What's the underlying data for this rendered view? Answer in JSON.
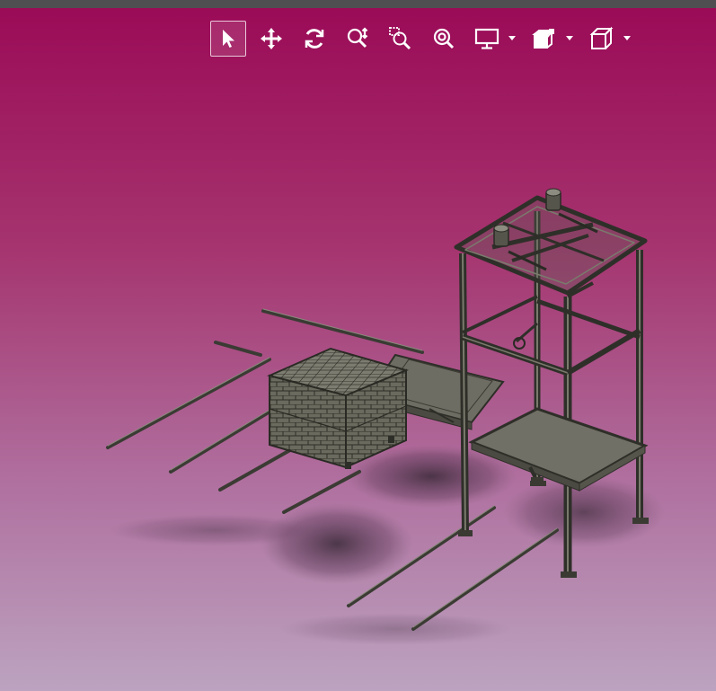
{
  "toolbar": {
    "buttons": [
      {
        "name": "select-icon",
        "active": true
      },
      {
        "name": "pan-icon",
        "active": false
      },
      {
        "name": "rotate-icon",
        "active": false
      },
      {
        "name": "zoom-icon",
        "active": false
      },
      {
        "name": "zoom-box-icon",
        "active": false
      },
      {
        "name": "zoom-fit-icon",
        "active": false
      },
      {
        "name": "display-mode-icon",
        "active": false,
        "dropdown": true
      },
      {
        "name": "render-style-icon",
        "active": false,
        "dropdown": true
      },
      {
        "name": "view-orientation-icon",
        "active": false,
        "dropdown": true
      }
    ]
  },
  "colors": {
    "viewport_top": "#9b0b57",
    "viewport_bottom": "#bca3c0",
    "frame": "#4b4b42",
    "frame_light": "#7a7a6d",
    "platform": "#6b6b62",
    "toolbar_icon": "#ffffff"
  }
}
